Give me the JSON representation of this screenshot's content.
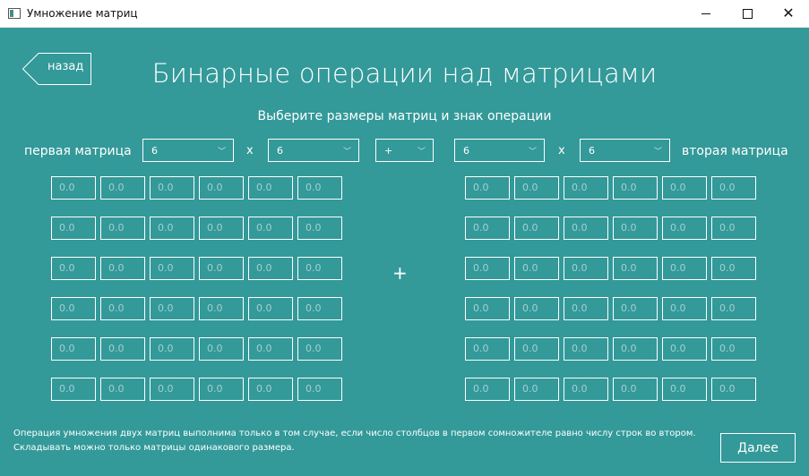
{
  "window": {
    "title": "Умножение матриц"
  },
  "header": {
    "back_label": "назад",
    "title": "Бинарные операции над матрицами",
    "subtitle": "Выберите размеры матриц и знак операции"
  },
  "controls": {
    "first_label": "первая матрица",
    "second_label": "вторая матрица",
    "times_sign": "x",
    "first_rows": "6",
    "first_cols": "6",
    "operation": "+",
    "second_rows": "6",
    "second_cols": "6"
  },
  "operation_sign": "+",
  "matrix_a": [
    [
      "0.0",
      "0.0",
      "0.0",
      "0.0",
      "0.0",
      "0.0"
    ],
    [
      "0.0",
      "0.0",
      "0.0",
      "0.0",
      "0.0",
      "0.0"
    ],
    [
      "0.0",
      "0.0",
      "0.0",
      "0.0",
      "0.0",
      "0.0"
    ],
    [
      "0.0",
      "0.0",
      "0.0",
      "0.0",
      "0.0",
      "0.0"
    ],
    [
      "0.0",
      "0.0",
      "0.0",
      "0.0",
      "0.0",
      "0.0"
    ],
    [
      "0.0",
      "0.0",
      "0.0",
      "0.0",
      "0.0",
      "0.0"
    ]
  ],
  "matrix_b": [
    [
      "0.0",
      "0.0",
      "0.0",
      "0.0",
      "0.0",
      "0.0"
    ],
    [
      "0.0",
      "0.0",
      "0.0",
      "0.0",
      "0.0",
      "0.0"
    ],
    [
      "0.0",
      "0.0",
      "0.0",
      "0.0",
      "0.0",
      "0.0"
    ],
    [
      "0.0",
      "0.0",
      "0.0",
      "0.0",
      "0.0",
      "0.0"
    ],
    [
      "0.0",
      "0.0",
      "0.0",
      "0.0",
      "0.0",
      "0.0"
    ],
    [
      "0.0",
      "0.0",
      "0.0",
      "0.0",
      "0.0",
      "0.0"
    ]
  ],
  "footer": {
    "note_line1": "Операция умножения двух матриц выполнима только в том случае, если число столбцов в первом сомножителе равно числу строк во втором.",
    "note_line2": "Складывать можно только матрицы одинакового размера.",
    "next_label": "Далее"
  },
  "colors": {
    "background": "#339999",
    "text": "#ffffff",
    "placeholder": "#a5d0d0"
  }
}
